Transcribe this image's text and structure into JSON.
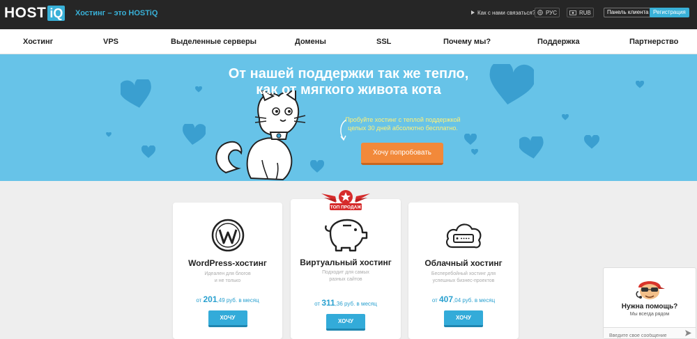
{
  "topbar": {
    "logo_text": "HOST",
    "logo_accent": "iQ",
    "tagline": "Хостинг – это HOSTiQ",
    "contact": "Как с нами связаться?",
    "language": "РУС",
    "currency": "RUB",
    "client_panel": "Панель клиента",
    "register": "Регистрация"
  },
  "nav": {
    "items": [
      "Хостинг",
      "VPS",
      "Выделенные серверы",
      "Домены",
      "SSL",
      "Почему мы?",
      "Поддержка",
      "Партнерство"
    ]
  },
  "hero": {
    "title_line1": "От нашей поддержки так же тепло,",
    "title_line2": "как от мягкого живота кота",
    "subtitle_line1": "Пробуйте хостинг с теплой поддержкой",
    "subtitle_line2": "целых 30 дней абсолютно бесплатно.",
    "cta": "Хочу попробовать"
  },
  "badge": {
    "text": "ТОП ПРОДАЖ"
  },
  "cards": [
    {
      "icon": "wordpress-icon",
      "title": "WordPress-хостинг",
      "desc_line1": "Идеален для блогов",
      "desc_line2": "и не только",
      "price_prefix": "от",
      "price_int": "201",
      "price_dec": ",49 руб. в месяц",
      "button": "ХОЧУ"
    },
    {
      "icon": "piggy-bank-icon",
      "title": "Виртуальный хостинг",
      "desc_line1": "Подходит для самых",
      "desc_line2": "разных сайтов",
      "price_prefix": "от",
      "price_int": "311",
      "price_dec": ",36 руб. в месяц",
      "button": "ХОЧУ"
    },
    {
      "icon": "cloud-server-icon",
      "title": "Облачный хостинг",
      "desc_line1": "Бесперебойный хостинг для",
      "desc_line2": "успешных бизнес-проектов",
      "price_prefix": "от",
      "price_int": "407",
      "price_dec": ",04 руб. в месяц",
      "button": "ХОЧУ"
    }
  ],
  "chat": {
    "title": "Нужна помощь?",
    "subtitle": "Мы всегда рядом",
    "placeholder": "Введите свое сообщение"
  },
  "colors": {
    "accent": "#39b1d8",
    "hero_bg": "#67c3e8",
    "cta_orange": "#f2893a",
    "heart": "#3a9fd0",
    "topbar": "#262626"
  }
}
